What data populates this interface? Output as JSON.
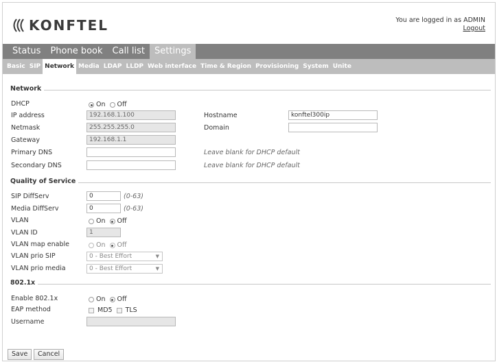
{
  "header": {
    "logo_text": "KONFTEL",
    "logged_in_text": "You are logged in as ADMIN",
    "logout_label": "Logout"
  },
  "main_tabs": [
    {
      "label": "Status",
      "active": false
    },
    {
      "label": "Phone book",
      "active": false
    },
    {
      "label": "Call list",
      "active": false
    },
    {
      "label": "Settings",
      "active": true
    }
  ],
  "sub_tabs": [
    {
      "label": "Basic",
      "active": false
    },
    {
      "label": "SIP",
      "active": false
    },
    {
      "label": "Network",
      "active": true
    },
    {
      "label": "Media",
      "active": false
    },
    {
      "label": "LDAP",
      "active": false
    },
    {
      "label": "LLDP",
      "active": false
    },
    {
      "label": "Web interface",
      "active": false
    },
    {
      "label": "Time & Region",
      "active": false
    },
    {
      "label": "Provisioning",
      "active": false
    },
    {
      "label": "System",
      "active": false
    },
    {
      "label": "Unite",
      "active": false
    }
  ],
  "network": {
    "title": "Network",
    "dhcp": {
      "label": "DHCP",
      "on": "On",
      "off": "Off",
      "selected": "On"
    },
    "ip_address": {
      "label": "IP address",
      "value": "192.168.1.100"
    },
    "netmask": {
      "label": "Netmask",
      "value": "255.255.255.0"
    },
    "gateway": {
      "label": "Gateway",
      "value": "192.168.1.1"
    },
    "primary_dns": {
      "label": "Primary DNS",
      "value": "",
      "hint": "Leave blank for DHCP default"
    },
    "secondary_dns": {
      "label": "Secondary DNS",
      "value": "",
      "hint": "Leave blank for DHCP default"
    },
    "hostname": {
      "label": "Hostname",
      "value": "konftel300ip"
    },
    "domain": {
      "label": "Domain",
      "value": ""
    }
  },
  "qos": {
    "title": "Quality of Service",
    "sip_diffserv": {
      "label": "SIP DiffServ",
      "value": "0",
      "range": "(0-63)"
    },
    "media_diffserv": {
      "label": "Media DiffServ",
      "value": "0",
      "range": "(0-63)"
    },
    "vlan": {
      "label": "VLAN",
      "on": "On",
      "off": "Off",
      "selected": "Off"
    },
    "vlan_id": {
      "label": "VLAN ID",
      "value": "1"
    },
    "vlan_map_enable": {
      "label": "VLAN map enable",
      "on": "On",
      "off": "Off",
      "selected": "Off"
    },
    "vlan_prio_sip": {
      "label": "VLAN prio SIP",
      "value": "0 - Best Effort"
    },
    "vlan_prio_media": {
      "label": "VLAN prio media",
      "value": "0 - Best Effort"
    }
  },
  "dot1x": {
    "title": "802.1x",
    "enable": {
      "label": "Enable 802.1x",
      "on": "On",
      "off": "Off",
      "selected": "Off"
    },
    "eap_method": {
      "label": "EAP method",
      "md5": "MD5",
      "tls": "TLS"
    },
    "username": {
      "label": "Username",
      "value": ""
    }
  },
  "buttons": {
    "save": "Save",
    "cancel": "Cancel"
  },
  "colors": {
    "nav_dark": "#808080",
    "nav_light": "#bdbdbd"
  }
}
